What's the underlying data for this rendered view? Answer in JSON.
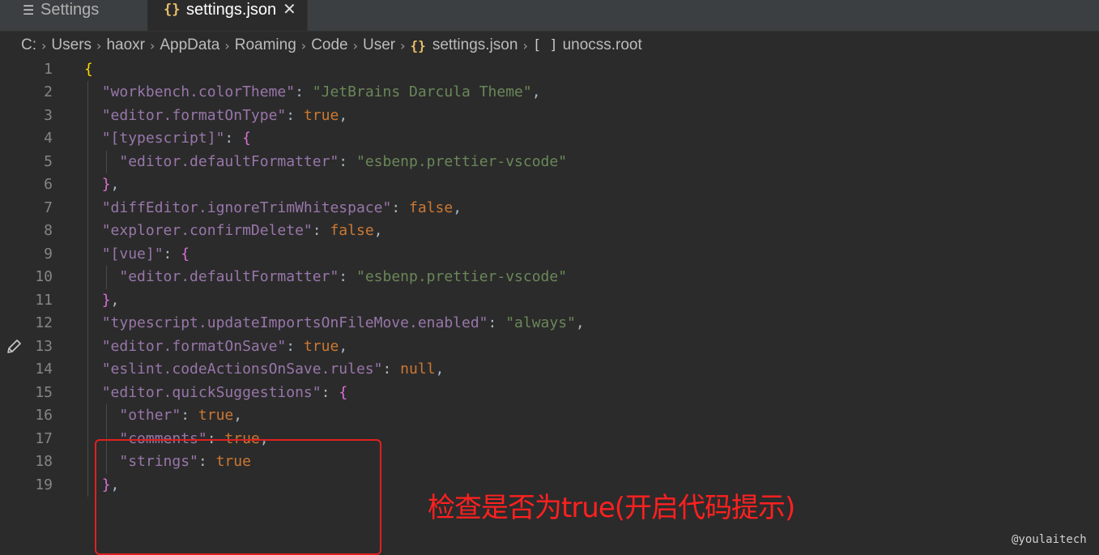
{
  "tabs": [
    {
      "label": "Settings",
      "icon": "list-lines-icon",
      "active": false
    },
    {
      "label": "settings.json",
      "icon": "json-braces-icon",
      "active": true,
      "close_glyph": "✕"
    }
  ],
  "breadcrumb": [
    "C:",
    "Users",
    "haoxr",
    "AppData",
    "Roaming",
    "Code",
    "User",
    "settings.json",
    "unocss.root"
  ],
  "editor": {
    "line_numbers": [
      "1",
      "2",
      "3",
      "4",
      "5",
      "6",
      "7",
      "8",
      "9",
      "10",
      "11",
      "12",
      "13",
      "14",
      "15",
      "16",
      "17",
      "18",
      "19"
    ],
    "lines": [
      "{",
      "  \"workbench.colorTheme\": \"JetBrains Darcula Theme\",",
      "  \"editor.formatOnType\": true,",
      "  \"[typescript]\": {",
      "    \"editor.defaultFormatter\": \"esbenp.prettier-vscode\"",
      "  },",
      "  \"diffEditor.ignoreTrimWhitespace\": false,",
      "  \"explorer.confirmDelete\": false,",
      "  \"[vue]\": {",
      "    \"editor.defaultFormatter\": \"esbenp.prettier-vscode\"",
      "  },",
      "  \"typescript.updateImportsOnFileMove.enabled\": \"always\",",
      "  \"editor.formatOnSave\": true,",
      "  \"eslint.codeActionsOnSave.rules\": null,",
      "  \"editor.quickSuggestions\": {",
      "    \"other\": true,",
      "    \"comments\": true,",
      "    \"strings\": true",
      "  },"
    ],
    "modified_line": "13"
  },
  "annotation": "检查是否为true(开启代码提示)",
  "watermark": "@youlaitech",
  "colors": {
    "background": "#2b2b2b",
    "key": "#9876aa",
    "string": "#6a8759",
    "keyword": "#cc7832",
    "bracket_outer": "#ffd700",
    "bracket_inner": "#da70d6",
    "annotation": "#e02020"
  }
}
